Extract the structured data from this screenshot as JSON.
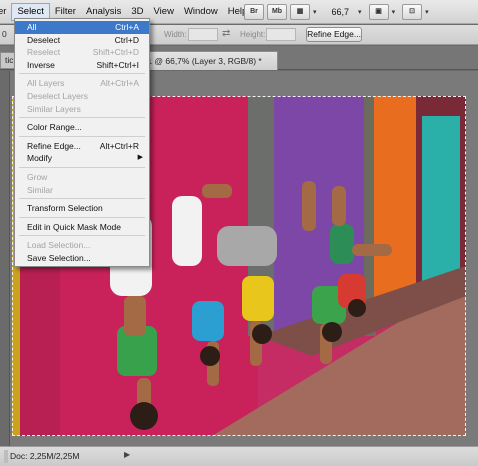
{
  "menubar": {
    "items": [
      "er",
      "Select",
      "Filter",
      "Analysis",
      "3D",
      "View",
      "Window",
      "Help"
    ],
    "tools": [
      "Br",
      "Mb"
    ],
    "zoom": "66,7"
  },
  "options_bar": {
    "left_text": "0",
    "width_label": "Width:",
    "height_label": "Height:",
    "refine_edge": "Refine Edge..."
  },
  "tabs": {
    "left": "ticul",
    "document": "ed-1 @ 66,7% (Layer 3, RGB/8) *"
  },
  "select_menu": {
    "items": [
      {
        "label": "All",
        "shortcut": "Ctrl+A",
        "state": "highlighted"
      },
      {
        "label": "Deselect",
        "shortcut": "Ctrl+D",
        "state": "enabled"
      },
      {
        "label": "Reselect",
        "shortcut": "Shift+Ctrl+D",
        "state": "disabled"
      },
      {
        "label": "Inverse",
        "shortcut": "Shift+Ctrl+I",
        "state": "enabled"
      },
      {
        "sep": true
      },
      {
        "label": "All Layers",
        "shortcut": "Alt+Ctrl+A",
        "state": "disabled"
      },
      {
        "label": "Deselect Layers",
        "shortcut": "",
        "state": "disabled"
      },
      {
        "label": "Similar Layers",
        "shortcut": "",
        "state": "disabled"
      },
      {
        "sep": true
      },
      {
        "label": "Color Range...",
        "shortcut": "",
        "state": "enabled"
      },
      {
        "sep": true
      },
      {
        "label": "Refine Edge...",
        "shortcut": "Alt+Ctrl+R",
        "state": "enabled"
      },
      {
        "label": "Modify",
        "shortcut": "",
        "state": "submenu"
      },
      {
        "sep": true
      },
      {
        "label": "Grow",
        "shortcut": "",
        "state": "disabled"
      },
      {
        "label": "Similar",
        "shortcut": "",
        "state": "disabled"
      },
      {
        "sep": true
      },
      {
        "label": "Transform Selection",
        "shortcut": "",
        "state": "enabled"
      },
      {
        "sep": true
      },
      {
        "label": "Edit in Quick Mask Mode",
        "shortcut": "",
        "state": "enabled"
      },
      {
        "sep": true
      },
      {
        "label": "Load Selection...",
        "shortcut": "",
        "state": "disabled"
      },
      {
        "label": "Save Selection...",
        "shortcut": "",
        "state": "enabled"
      }
    ]
  },
  "status": {
    "doc": "Doc: 2,25M/2,25M"
  }
}
